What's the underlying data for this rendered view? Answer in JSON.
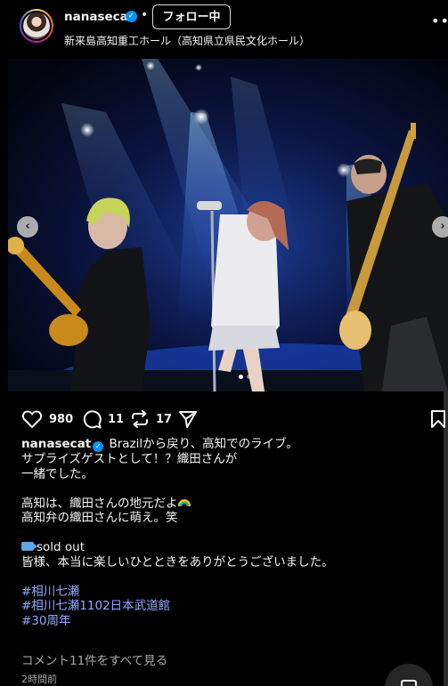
{
  "header": {
    "username": "nanasecat",
    "verified_mark": "✓",
    "separator": "•",
    "follow_label": "フォロー中",
    "location": "新来島高知重工ホール（高知県立県民文化ホール）",
    "more_icon": "more-horizontal-icon"
  },
  "carousel": {
    "prev_icon": "chevron-left-icon",
    "next_icon": "chevron-right-icon",
    "pages": 2,
    "active_page": 1
  },
  "actions": {
    "likes": "980",
    "comments": "11",
    "reposts": "17"
  },
  "caption": {
    "username": "nanasecat",
    "lines": [
      "Brazilから戻り、高知でのライブ。",
      "サプライズゲストとして！？織田さんが",
      "一緒でした。",
      "",
      "高知は、織田さんの地元だよ",
      "高知弁の織田さんに萌え。笑",
      "",
      "sold out",
      "皆様、本当に楽しいひとときをありがとうございました。",
      ""
    ],
    "hashtags": [
      "#相川七瀬",
      "#相川七瀬1102日本武道館",
      "#30周年"
    ]
  },
  "footer": {
    "view_comments": "コメント11件をすべて見る",
    "timestamp": "2時間前"
  },
  "colors": {
    "background": "#000000",
    "verified": "#0095f6",
    "hashtag": "#8ea9ff",
    "muted": "#a8a8a8"
  }
}
